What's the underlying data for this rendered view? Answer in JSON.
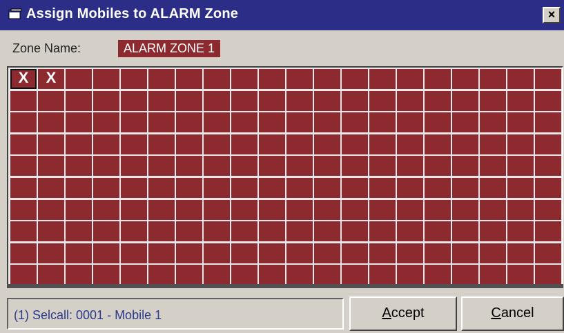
{
  "window": {
    "title": "Assign Mobiles to ALARM Zone",
    "close_label": "×"
  },
  "zone": {
    "label": "Zone Name:",
    "value": "ALARM ZONE 1"
  },
  "grid": {
    "columns": 20,
    "rows": 10,
    "marked_cells": [
      0,
      1
    ],
    "selected_cell": 0,
    "mark_glyph": "X",
    "cell_color": "#8d2a30"
  },
  "status": {
    "text": "(1) Selcall: 0001 - Mobile 1"
  },
  "buttons": {
    "accept_mnemonic": "A",
    "accept_rest": "ccept",
    "cancel_mnemonic": "C",
    "cancel_rest": "ancel"
  },
  "colors": {
    "titlebar": "#2b2d86",
    "accent": "#8d2a30",
    "face": "#d4d0c8"
  }
}
